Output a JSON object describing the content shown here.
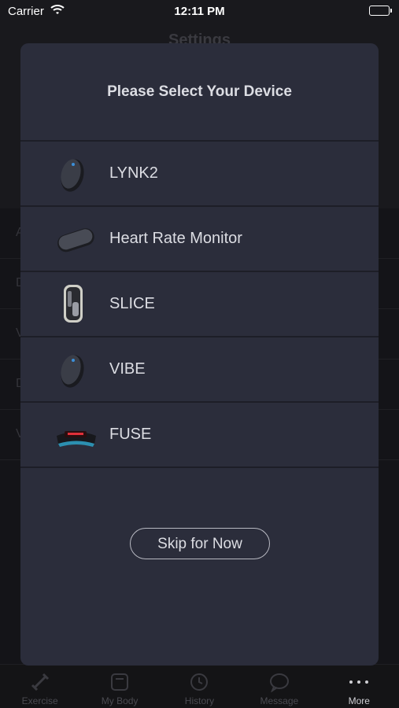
{
  "status_bar": {
    "carrier": "Carrier",
    "time": "12:11 PM"
  },
  "background": {
    "title": "Settings",
    "rows": [
      "A",
      "D",
      "V",
      "D",
      "V"
    ],
    "tabs": [
      {
        "label": "Exercise",
        "icon": "dumbbell-icon",
        "active": false
      },
      {
        "label": "My Body",
        "icon": "scale-icon",
        "active": false
      },
      {
        "label": "History",
        "icon": "history-icon",
        "active": false
      },
      {
        "label": "Message",
        "icon": "chat-bubble-icon",
        "active": false
      },
      {
        "label": "More",
        "icon": "more-dots-icon",
        "active": true
      }
    ]
  },
  "modal": {
    "title": "Please Select Your Device",
    "devices": [
      {
        "name": "LYNK2",
        "icon": "lynk2-device-icon"
      },
      {
        "name": "Heart Rate Monitor",
        "icon": "heart-rate-monitor-icon"
      },
      {
        "name": "SLICE",
        "icon": "slice-device-icon"
      },
      {
        "name": "VIBE",
        "icon": "vibe-device-icon"
      },
      {
        "name": "FUSE",
        "icon": "fuse-device-icon"
      }
    ],
    "skip_label": "Skip for Now"
  },
  "colors": {
    "modal_bg": "#2b2d3b",
    "divider": "#1d1e27",
    "text": "#dcdde3"
  }
}
